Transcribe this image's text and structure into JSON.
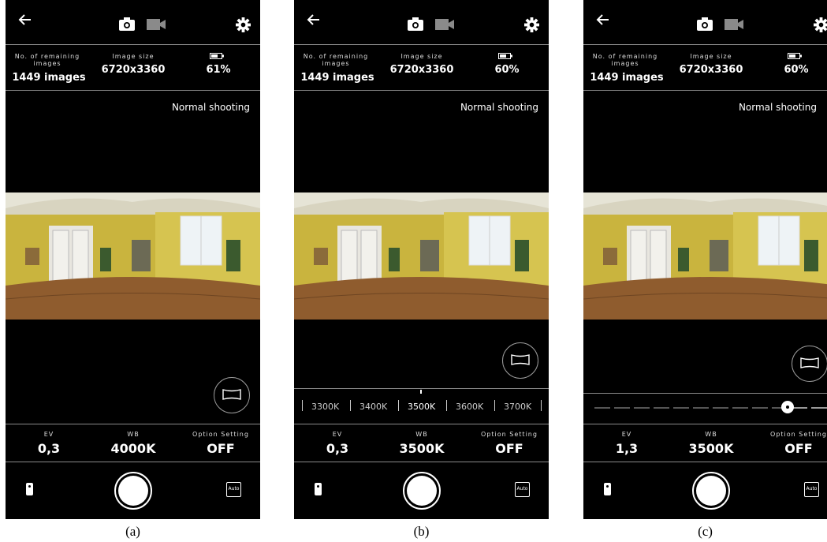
{
  "screens": [
    {
      "caption": "(a)",
      "remaining_label": "No. of remaining images",
      "remaining_value": "1449 images",
      "size_label": "Image size",
      "size_value": "6720x3360",
      "battery_value": "61%",
      "mode": "Normal shooting",
      "ev_label": "EV",
      "ev_value": "0,3",
      "wb_label": "WB",
      "wb_value": "4000K",
      "option_label": "Option Setting",
      "option_value": "OFF",
      "auto_label": "Auto"
    },
    {
      "caption": "(b)",
      "remaining_label": "No. of remaining images",
      "remaining_value": "1449 images",
      "size_label": "Image size",
      "size_value": "6720x3360",
      "battery_value": "60%",
      "mode": "Normal shooting",
      "ev_label": "EV",
      "ev_value": "0,3",
      "wb_label": "WB",
      "wb_value": "3500K",
      "option_label": "Option Setting",
      "option_value": "OFF",
      "auto_label": "Auto",
      "wb_scale": [
        "3300K",
        "3400K",
        "3500K",
        "3600K",
        "3700K"
      ],
      "wb_selected": "3500K"
    },
    {
      "caption": "(c)",
      "remaining_label": "No. of remaining images",
      "remaining_value": "1449 images",
      "size_label": "Image size",
      "size_value": "6720x3360",
      "battery_value": "60%",
      "mode": "Normal shooting",
      "ev_label": "EV",
      "ev_value": "1,3",
      "wb_label": "WB",
      "wb_value": "3500K",
      "option_label": "Option Setting",
      "option_value": "OFF",
      "auto_label": "Auto"
    }
  ],
  "icons": {
    "back": "arrow-left-icon",
    "camera": "camera-icon",
    "video": "video-icon",
    "settings": "gear-icon",
    "battery": "battery-icon",
    "view": "panorama-view-icon",
    "remote": "remote-icon",
    "auto": "auto-icon"
  },
  "colors": {
    "background": "#000000",
    "text": "#ffffff",
    "divider": "#8a8a8a",
    "wall": "#c9b74a",
    "floor": "#8b5a2b"
  }
}
